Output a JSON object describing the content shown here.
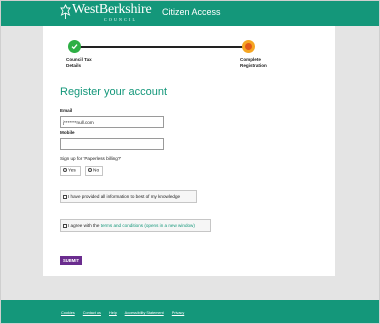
{
  "header": {
    "logo_text": "WestBerkshire",
    "logo_sub": "COUNCIL",
    "title": "Citizen Access"
  },
  "progress": {
    "steps": [
      {
        "label_line1": "Council Tax",
        "label_line2": "Details",
        "status": "complete"
      },
      {
        "label_line1": "Complete",
        "label_line2": "Registration",
        "status": "current"
      }
    ]
  },
  "form": {
    "title": "Register your account",
    "email_label": "Email",
    "email_value": "j*******null.com",
    "mobile_label": "Mobile",
    "mobile_value": "",
    "paperless_question": "Sign up for 'Paperless billing?'",
    "radio_yes": "Yes",
    "radio_no": "No",
    "confirm_text": "I have provided all information to best of my knowledge",
    "agree_prefix": "I agree with the ",
    "agree_link": "terms and conditions (opens in a new window)",
    "submit_label": "SUBMIT"
  },
  "footer": {
    "links": [
      "Cookies",
      "Contact us",
      "Help",
      "Accessibility Statement",
      "Privacy"
    ]
  },
  "colors": {
    "brand": "#14977a",
    "submit": "#6a2c8e",
    "step_complete": "#2eaf45",
    "step_current": "#f5a623"
  }
}
